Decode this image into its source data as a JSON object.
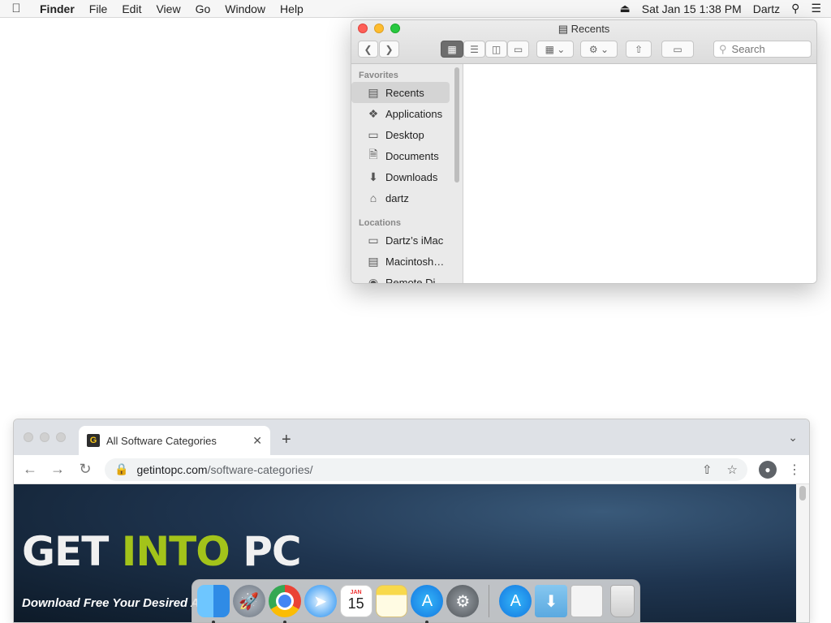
{
  "menubar": {
    "apple_icon": "apple-logo",
    "app_name": "Finder",
    "menus": [
      "File",
      "Edit",
      "View",
      "Go",
      "Window",
      "Help"
    ],
    "date_time": "Sat Jan 15  1:38 PM",
    "user": "Dartz"
  },
  "finder": {
    "title": "Recents",
    "search_placeholder": "Search",
    "favorites_label": "Favorites",
    "favorites": [
      {
        "label": "Recents",
        "icon": "recents-icon"
      },
      {
        "label": "Applications",
        "icon": "applications-icon"
      },
      {
        "label": "Desktop",
        "icon": "desktop-icon"
      },
      {
        "label": "Documents",
        "icon": "documents-icon"
      },
      {
        "label": "Downloads",
        "icon": "downloads-icon"
      },
      {
        "label": "dartz",
        "icon": "home-icon"
      }
    ],
    "locations_label": "Locations",
    "locations": [
      {
        "label": "Dartz’s iMac",
        "icon": "imac-icon"
      },
      {
        "label": "Macintosh…",
        "icon": "hard-drive-icon"
      },
      {
        "label": "Remote Di…",
        "icon": "remote-disc-icon"
      }
    ]
  },
  "browser": {
    "tab_title": "All Software Categories",
    "favicon_letter": "G",
    "url_host": "getintopc.com",
    "url_path": "/software-categories/",
    "logo_word1": "GET ",
    "logo_word2": "INTO",
    "logo_word3": " PC",
    "tagline": "Download Free Your Desired A",
    "colors": {
      "logo_green": "#a3c31a",
      "logo_white": "#f0f0f0"
    }
  },
  "dock": {
    "calendar_month": "JAN",
    "calendar_day": "15",
    "apps": [
      "Finder",
      "Launchpad",
      "Google Chrome",
      "Safari",
      "Calendar",
      "Notes",
      "App Store",
      "System Preferences",
      "App Store Downloads",
      "Downloads",
      "Preview",
      "Trash"
    ]
  }
}
